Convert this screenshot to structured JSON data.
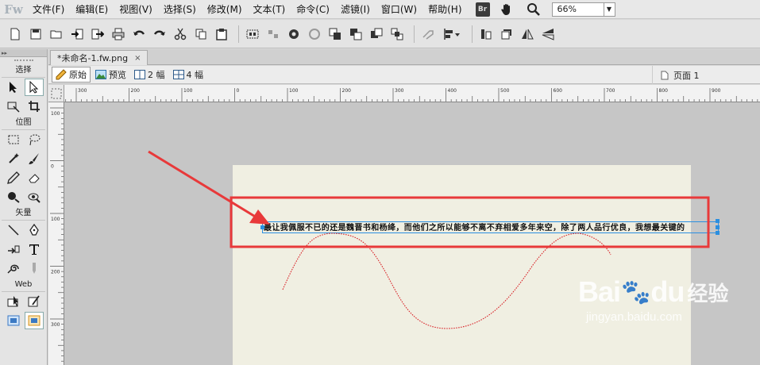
{
  "app": {
    "logo": "Fw",
    "br_badge": "Br"
  },
  "menu": [
    "文件(F)",
    "编辑(E)",
    "视图(V)",
    "选择(S)",
    "修改(M)",
    "文本(T)",
    "命令(C)",
    "滤镜(I)",
    "窗口(W)",
    "帮助(H)"
  ],
  "zoom": {
    "value": "66%"
  },
  "tools_panel": {
    "sections": {
      "select": "选择",
      "bitmap": "位图",
      "vector": "矢量",
      "web": "Web"
    }
  },
  "document": {
    "tab_title": "*未命名-1.fw.png",
    "close": "×"
  },
  "viewbar": {
    "original": "原始",
    "preview": "预览",
    "two_up": "2 幅",
    "four_up": "4 幅",
    "page": "页面 1"
  },
  "rulers": {
    "h_labels": [
      "300",
      "200",
      "100",
      "0",
      "100",
      "200",
      "300",
      "400",
      "500",
      "600",
      "700",
      "800",
      "900"
    ],
    "v_labels": [
      "100",
      "0",
      "100",
      "200",
      "300"
    ]
  },
  "canvas": {
    "text": "最让我佩服不已的还是魏晋书和杨绛，而他们之所以能够不离不弃相爱多年来空，除了两人品行优良，我想最关键的"
  },
  "watermark": {
    "logo_a": "Bai",
    "logo_b": "du",
    "logo_cn": "经验",
    "url": "jingyan.baidu.com"
  },
  "colors": {
    "selection": "#2b8fe0",
    "highlight_box": "#e8393a",
    "arrow": "#e8393a",
    "path": "#d9262b"
  }
}
